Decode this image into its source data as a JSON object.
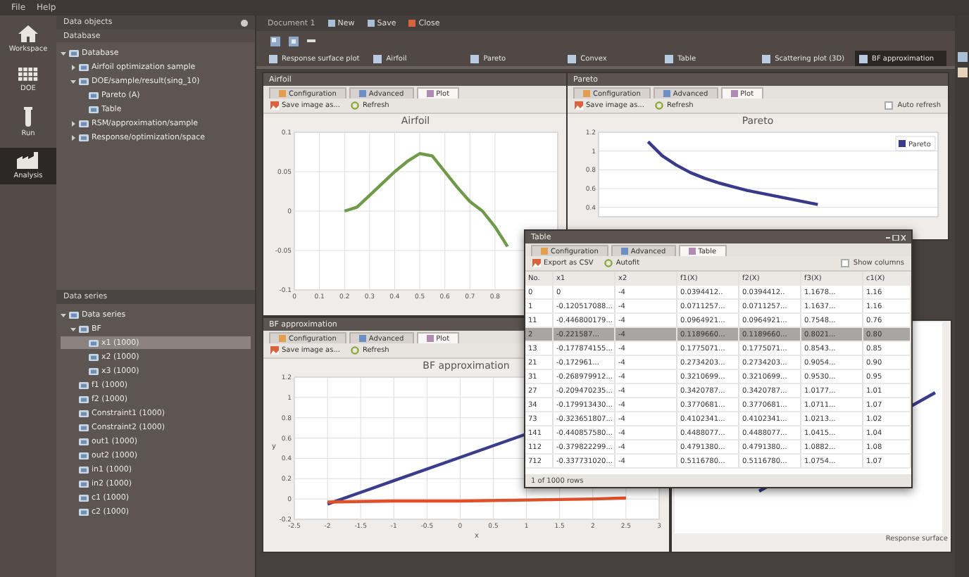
{
  "menu": [
    "File",
    "Help"
  ],
  "nav": [
    {
      "label": "Workspace",
      "selected": false
    },
    {
      "label": "DOE",
      "selected": false
    },
    {
      "label": "Run",
      "selected": false
    },
    {
      "label": "Analysis",
      "selected": true
    }
  ],
  "data_objects": {
    "title": "Data objects",
    "subtitle": "Database",
    "tree": [
      {
        "label": "Database",
        "expanded": true,
        "selected": false,
        "children": [
          {
            "label": "Airfoil optimization sample",
            "expanded": false,
            "selected": false
          },
          {
            "label": "DOE/sample/result(sing_10)",
            "expanded": true,
            "selected": false,
            "children": [
              {
                "label": "Pareto (A)",
                "selected": false
              },
              {
                "label": "Table",
                "selected": false
              }
            ]
          },
          {
            "label": "RSM/approximation/sample",
            "expanded": false,
            "selected": false
          },
          {
            "label": "Response/optimization/space",
            "expanded": false,
            "selected": false
          }
        ]
      }
    ]
  },
  "data_series": {
    "title": "Data series",
    "tree": [
      {
        "label": "Data series",
        "expanded": true,
        "selected": false,
        "children": [
          {
            "label": "BF",
            "expanded": true,
            "selected": false,
            "children": [
              {
                "label": "x1 (1000)",
                "selected": true
              },
              {
                "label": "x2 (1000)",
                "selected": false
              },
              {
                "label": "x3 (1000)",
                "selected": false
              }
            ]
          },
          {
            "label": "f1 (1000)",
            "selected": false
          },
          {
            "label": "f2 (1000)",
            "selected": false
          },
          {
            "label": "Constraint1 (1000)",
            "selected": false
          },
          {
            "label": "Constraint2 (1000)",
            "selected": false
          },
          {
            "label": "out1 (1000)",
            "selected": false
          },
          {
            "label": "out2 (1000)",
            "selected": false
          },
          {
            "label": "in1 (1000)",
            "selected": false
          },
          {
            "label": "in2 (1000)",
            "selected": false
          },
          {
            "label": "c1 (1000)",
            "selected": false
          },
          {
            "label": "c2 (1000)",
            "selected": false
          }
        ]
      }
    ]
  },
  "document_bar": {
    "title": "Document 1",
    "buttons": [
      "New",
      "Save",
      "Close"
    ]
  },
  "doc_tabs": [
    {
      "label": "Response surface plot",
      "selected": false
    },
    {
      "label": "Airfoil",
      "selected": false
    },
    {
      "label": "Pareto",
      "selected": false
    },
    {
      "label": "Convex",
      "selected": false
    },
    {
      "label": "Table",
      "selected": false
    },
    {
      "label": "Scattering plot (3D)",
      "selected": false
    },
    {
      "label": "BF approximation",
      "selected": true
    }
  ],
  "windows": [
    {
      "title": "Airfoil",
      "tabs": [
        {
          "label": "Configuration",
          "selected": false
        },
        {
          "label": "Advanced",
          "selected": false
        },
        {
          "label": "Plot",
          "selected": true
        }
      ],
      "actions": [
        "Save image as...",
        "Refresh"
      ],
      "chart_data": {
        "type": "line",
        "title": "Airfoil",
        "x": [
          0.2,
          0.25,
          0.3,
          0.35,
          0.4,
          0.45,
          0.5,
          0.55,
          0.6,
          0.65,
          0.7,
          0.75,
          0.8,
          0.85
        ],
        "series": [
          {
            "color": "#6f9a4a",
            "values": [
              0,
              0.005,
              0.02,
              0.035,
              0.05,
              0.063,
              0.073,
              0.07,
              0.05,
              0.03,
              0.012,
              0,
              -0.02,
              -0.045
            ]
          }
        ],
        "xlim": [
          0,
          1.05
        ],
        "ylim": [
          -0.1,
          0.1
        ],
        "xticks": [
          0,
          0.1,
          0.2,
          0.3,
          0.4,
          0.5,
          0.6,
          0.7,
          0.8
        ],
        "yticks": [
          -0.1,
          -0.05,
          0,
          0.05,
          0.1
        ],
        "grid": true
      }
    },
    {
      "title": "Pareto",
      "tabs": [
        {
          "label": "Configuration",
          "selected": false
        },
        {
          "label": "Advanced",
          "selected": false
        },
        {
          "label": "Plot",
          "selected": true
        }
      ],
      "actions": [
        "Save image as...",
        "Refresh"
      ],
      "checkbox": {
        "label": "Auto refresh",
        "checked": false
      },
      "chart_data": {
        "type": "line",
        "legend": true,
        "title": "Pareto",
        "grid": true,
        "categories": [
          null,
          null,
          null,
          null,
          null,
          null,
          null,
          null,
          null,
          null,
          null,
          null,
          null,
          null,
          null,
          null,
          null,
          null,
          null,
          null,
          null,
          null,
          null,
          null
        ],
        "series": [
          {
            "name": "Pareto",
            "color": "#3a3a8a",
            "values": [
              null,
              null,
              null,
              1.1,
              0.95,
              0.85,
              0.77,
              0.71,
              0.66,
              0.62,
              0.58,
              0.55,
              0.52,
              0.49,
              0.46,
              0.43,
              null,
              null,
              null,
              null,
              null,
              null,
              null,
              null
            ]
          }
        ],
        "ylim": [
          0.3,
          1.2
        ],
        "yticks": [
          0.4,
          0.6,
          0.8,
          1,
          1.2
        ]
      }
    },
    {
      "title": "BF approximation",
      "tabs": [
        {
          "label": "Configuration",
          "selected": false
        },
        {
          "label": "Advanced",
          "selected": false
        },
        {
          "label": "Plot",
          "selected": true
        }
      ],
      "actions": [
        "Save image as...",
        "Refresh"
      ],
      "chart_data": {
        "type": "line",
        "title": "BF approximation",
        "xlabel": "x",
        "ylabel": "y",
        "x": [
          -2,
          -1,
          0,
          1,
          2,
          2.5
        ],
        "series": [
          {
            "color": "#3c3c8c",
            "values": [
              -0.05,
              0.18,
              0.41,
              0.64,
              null,
              null
            ]
          },
          {
            "color": "#e0502a",
            "values": [
              -0.03,
              -0.02,
              -0.02,
              -0.01,
              0,
              0.01
            ]
          }
        ],
        "grid": true,
        "xlim": [
          -2.5,
          3
        ],
        "ylim": [
          -0.2,
          1.2
        ],
        "xticks": [
          -2.5,
          -2,
          -1.5,
          -1,
          -0.5,
          0,
          0.5,
          1,
          1.5,
          2,
          2.5,
          3
        ],
        "yticks": [
          -0.2,
          0,
          0.2,
          0.4,
          0.6,
          0.8,
          1,
          1.2
        ]
      }
    },
    {
      "kind": "plot",
      "xlabel": "Response surface"
    }
  ],
  "table_window": {
    "title": "Table",
    "tabs": [
      {
        "label": "Configuration",
        "selected": false
      },
      {
        "label": "Advanced",
        "selected": false
      },
      {
        "label": "Table",
        "selected": true
      }
    ],
    "actions": [
      "Export as CSV",
      "Autofit"
    ],
    "checkbox": {
      "label": "Show columns",
      "checked": false
    },
    "columns": [
      "No.",
      "x1",
      "x2",
      "f1(X)",
      "f2(X)",
      "f3(X)",
      "c1(X)"
    ],
    "rows": [
      {
        "cells": [
          "0",
          "0",
          "-4",
          "0.0394412..",
          "0.0394412..",
          "1.1678...",
          "1.16"
        ],
        "selected": false
      },
      {
        "cells": [
          "1",
          "-0.120517088...",
          "-4",
          "0.0711257...",
          "0.0711257...",
          "1.1637...",
          "1.16"
        ],
        "selected": false
      },
      {
        "cells": [
          "11",
          "-0.446800179...",
          "-4",
          "0.0964921...",
          "0.0964921...",
          "0.7548...",
          "0.76"
        ],
        "selected": false
      },
      {
        "cells": [
          "2",
          "-0.221587...",
          "-4",
          "0.1189660...",
          "0.1189660...",
          "0.8021...",
          "0.80"
        ],
        "selected": true
      },
      {
        "cells": [
          "13",
          "-0.177874155...",
          "-4",
          "0.1775071...",
          "0.1775071...",
          "0.8543...",
          "0.85"
        ],
        "selected": false
      },
      {
        "cells": [
          "21",
          "-0.172961...",
          "-4",
          "0.2734203...",
          "0.2734203...",
          "0.9054...",
          "0.90"
        ],
        "selected": false
      },
      {
        "cells": [
          "31",
          "-0.268979912...",
          "-4",
          "0.3210699...",
          "0.3210699...",
          "0.9530...",
          "0.95"
        ],
        "selected": false
      },
      {
        "cells": [
          "27",
          "-0.209470235...",
          "-4",
          "0.3420787...",
          "0.3420787...",
          "1.0177...",
          "1.01"
        ],
        "selected": false
      },
      {
        "cells": [
          "34",
          "-0.179913430...",
          "-4",
          "0.3770681...",
          "0.3770681...",
          "1.0711...",
          "1.07"
        ],
        "selected": false
      },
      {
        "cells": [
          "73",
          "-0.323651807...",
          "-4",
          "0.4102341...",
          "0.4102341...",
          "1.0213...",
          "1.02"
        ],
        "selected": false
      },
      {
        "cells": [
          "141",
          "-0.440857580...",
          "-4",
          "0.4488077...",
          "0.4488077...",
          "1.0415...",
          "1.04"
        ],
        "selected": false
      },
      {
        "cells": [
          "112",
          "-0.379822299...",
          "-4",
          "0.4791380...",
          "0.4791380...",
          "1.0882...",
          "1.08"
        ],
        "selected": false
      },
      {
        "cells": [
          "712",
          "-0.337731020...",
          "-4",
          "0.5116780...",
          "0.5116780...",
          "1.0754...",
          "1.07"
        ],
        "selected": false
      }
    ],
    "status": "1 of 1000 rows"
  }
}
